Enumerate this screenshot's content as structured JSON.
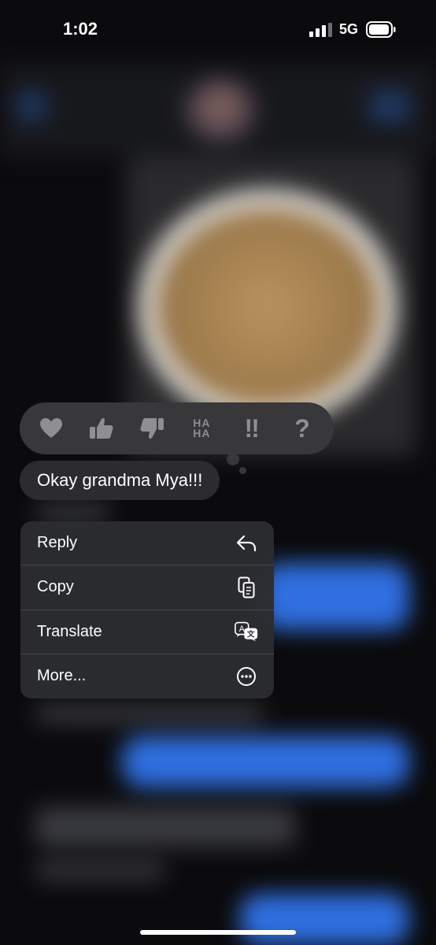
{
  "status_bar": {
    "time": "1:02",
    "network": "5G",
    "signal_bars": 3,
    "signal_bars_total": 4,
    "battery_level": 0.85
  },
  "reactions": [
    {
      "name": "heart-icon"
    },
    {
      "name": "thumbs-up-icon"
    },
    {
      "name": "thumbs-down-icon"
    },
    {
      "name": "haha-icon",
      "line1": "HA",
      "line2": "HA"
    },
    {
      "name": "exclamation-icon",
      "text": "‼"
    },
    {
      "name": "question-icon",
      "text": "?"
    }
  ],
  "message": {
    "text": "Okay grandma Mya!!!"
  },
  "menu": {
    "items": [
      {
        "label": "Reply",
        "icon": "reply-icon"
      },
      {
        "label": "Copy",
        "icon": "copy-icon"
      },
      {
        "label": "Translate",
        "icon": "translate-icon"
      },
      {
        "label": "More...",
        "icon": "more-icon"
      }
    ]
  },
  "colors": {
    "accent_blue": "#2f6fe0",
    "reaction_bar": "#38383b",
    "bubble": "#2c2c2f",
    "menu_bg": "#2c2d30",
    "icon_gray": "#8e8e93"
  }
}
